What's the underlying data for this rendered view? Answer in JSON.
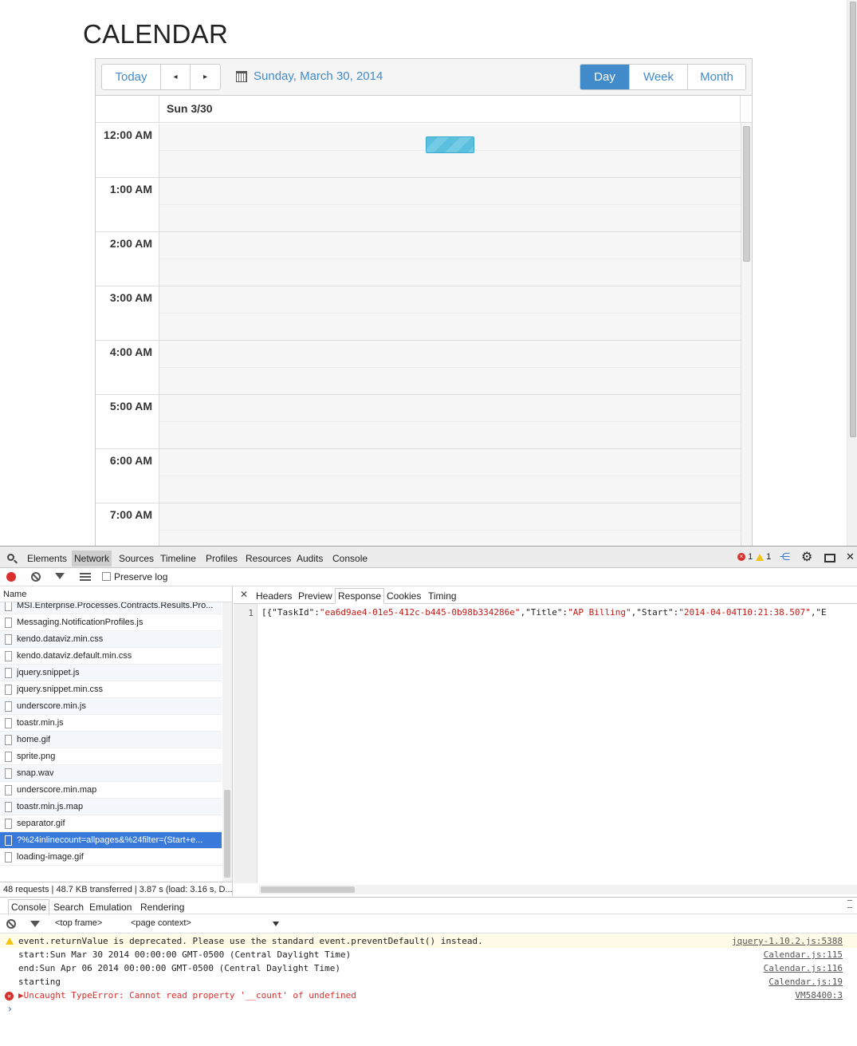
{
  "page": {
    "title": "CALENDAR"
  },
  "toolbar": {
    "today": "Today",
    "prev_arrow": "◂",
    "next_arrow": "▸",
    "date": "Sunday, March 30, 2014",
    "views": [
      "Day",
      "Week",
      "Month"
    ],
    "active_view": "Day"
  },
  "day_header": {
    "label": "Sun 3/30"
  },
  "time_slots": [
    "12:00 AM",
    "1:00 AM",
    "2:00 AM",
    "3:00 AM",
    "4:00 AM",
    "5:00 AM",
    "6:00 AM",
    "7:00 AM"
  ],
  "devtools": {
    "tabs": [
      "Elements",
      "Network",
      "Sources",
      "Timeline",
      "Profiles",
      "Resources",
      "Audits",
      "Console"
    ],
    "active_tab": "Network",
    "error_count": "1",
    "warning_count": "1",
    "preserve_log": "Preserve log",
    "name_header": "Name",
    "files": [
      "MSI.Enterprise.Processes.Contracts.Results.Pro...",
      "Messaging.NotificationProfiles.js",
      "kendo.dataviz.min.css",
      "kendo.dataviz.default.min.css",
      "jquery.snippet.js",
      "jquery.snippet.min.css",
      "underscore.min.js",
      "toastr.min.js",
      "home.gif",
      "sprite.png",
      "snap.wav",
      "underscore.min.map",
      "toastr.min.js.map",
      "separator.gif",
      "?%24inlinecount=allpages&%24filter=(Start+e...",
      "loading-image.gif"
    ],
    "selected_file": "?%24inlinecount=allpages&%24filter=(Start+e...",
    "summary": "48 requests | 48.7 KB transferred | 3.87 s (load: 3.16 s, D...",
    "detail_tabs": [
      "Headers",
      "Preview",
      "Response",
      "Cookies",
      "Timing"
    ],
    "active_detail_tab": "Response",
    "response": {
      "line_number": "1",
      "p1": "[{\"TaskId\":",
      "v1": "\"ea6d9ae4-01e5-412c-b445-0b98b334286e\"",
      "p2": ",\"Title\":",
      "v2": "\"AP Billing\"",
      "p3": ",\"Start\":",
      "v3": "\"2014-04-04T10:21:38.507\"",
      "p4": ",\"E"
    },
    "console_tabs": [
      "Console",
      "Search",
      "Emulation",
      "Rendering"
    ],
    "active_console_tab": "Console",
    "frame_select": "<top frame>",
    "context_select": "<page context>",
    "logs": [
      {
        "type": "warning",
        "message": "event.returnValue is deprecated. Please use the standard event.preventDefault() instead.",
        "source": "jquery-1.10.2.js:5388"
      },
      {
        "type": "log",
        "message": "start:Sun Mar 30 2014 00:00:00 GMT-0500 (Central Daylight Time)",
        "source": "Calendar.js:115"
      },
      {
        "type": "log",
        "message": "end:Sun Apr 06 2014 00:00:00 GMT-0500 (Central Daylight Time)",
        "source": "Calendar.js:116"
      },
      {
        "type": "log",
        "message": "starting",
        "source": "Calendar.js:19"
      },
      {
        "type": "error",
        "message": "▶Uncaught TypeError: Cannot read property '__count' of undefined",
        "source": "VM58400:3"
      }
    ],
    "prompt": "›"
  }
}
